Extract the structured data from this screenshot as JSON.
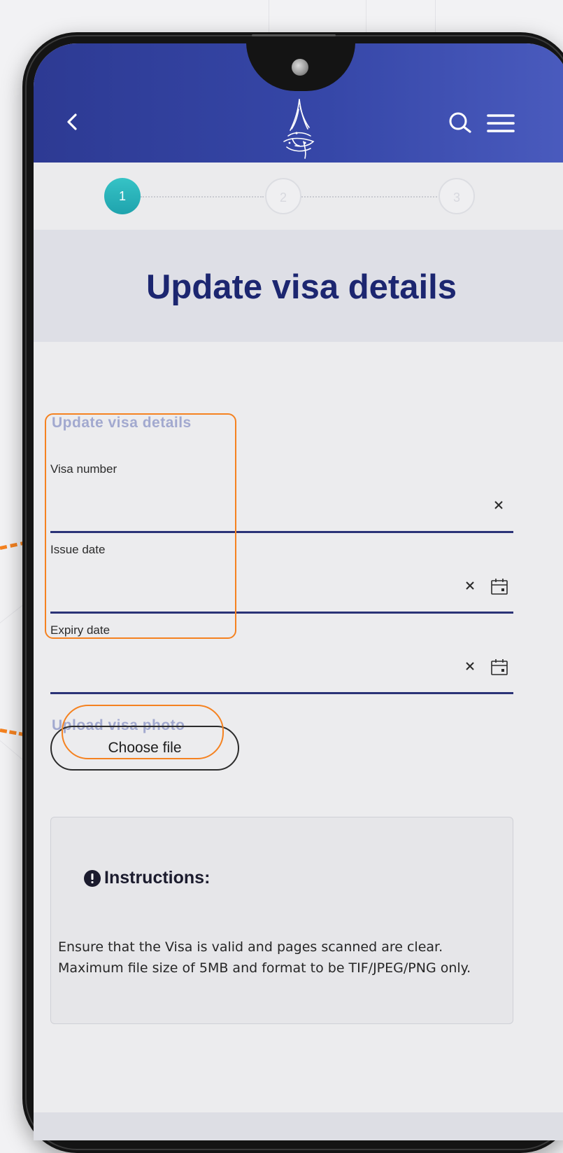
{
  "header": {
    "back_icon": "chevron-left-icon",
    "logo_icon": "calligraphy-logo-icon",
    "search_icon": "search-icon",
    "menu_icon": "hamburger-menu-icon",
    "colors": {
      "header_start": "#2d3a93",
      "header_end": "#4a5bbe"
    }
  },
  "stepper": {
    "steps": [
      {
        "label": "1",
        "state": "active"
      },
      {
        "label": "2",
        "state": "inactive"
      },
      {
        "label": "3",
        "state": "inactive"
      }
    ],
    "colors": {
      "active": "#2bb5bb"
    }
  },
  "page": {
    "title": "Update visa details"
  },
  "form": {
    "section_title": "Update visa details",
    "fields": [
      {
        "label": "Visa number",
        "value": "",
        "actions": [
          "clear-icon"
        ]
      },
      {
        "label": "Issue date",
        "value": "",
        "actions": [
          "clear-icon",
          "calendar-icon"
        ]
      },
      {
        "label": "Expiry date",
        "value": "",
        "actions": [
          "clear-icon",
          "calendar-icon"
        ]
      }
    ]
  },
  "upload": {
    "section_title": "Upload visa photo",
    "button_label": "Choose file"
  },
  "instructions": {
    "icon": "info-icon",
    "title": "Instructions:",
    "text": "Ensure that the Visa is valid and pages scanned are clear. Maximum file size of 5MB and format to be TIF/JPEG/PNG only."
  },
  "annotation": {
    "highlight_color": "#f58220"
  }
}
